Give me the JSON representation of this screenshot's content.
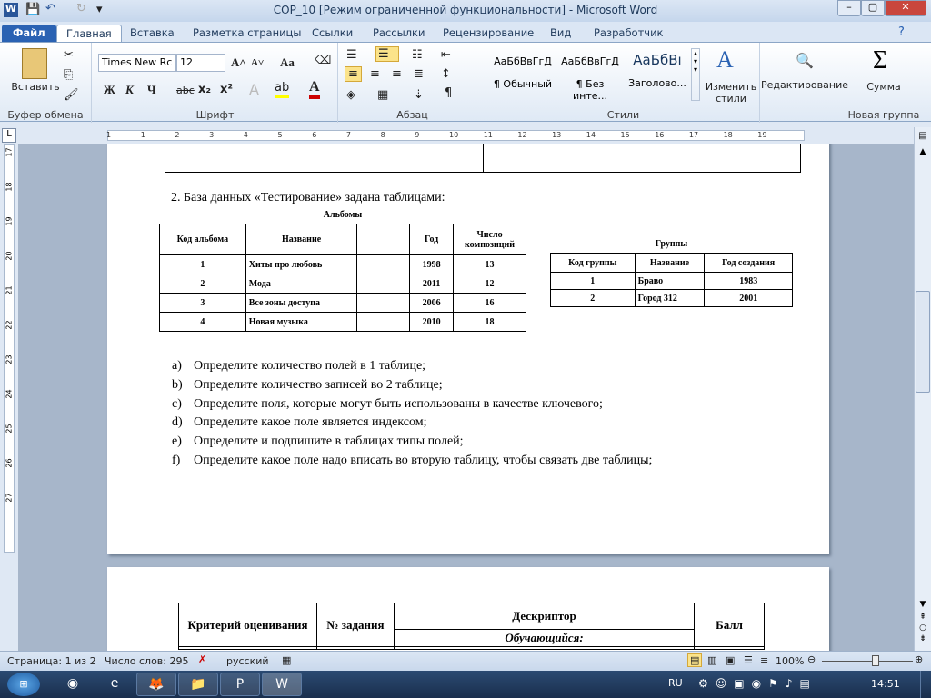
{
  "window": {
    "title": "COP_10 [Режим ограниченной функциональности]  -  Microsoft Word",
    "minimize": "–",
    "maximize": "▢",
    "close": "✕"
  },
  "quick_access": {
    "word": "W",
    "save": "💾",
    "undo": "↶",
    "redo": "↻",
    "customize": "▾"
  },
  "tabs": [
    "Файл",
    "Главная",
    "Вставка",
    "Разметка страницы",
    "Ссылки",
    "Рассылки",
    "Рецензирование",
    "Вид",
    "Разработчик"
  ],
  "ribbon": {
    "clipboard": {
      "paste": "Вставить",
      "label": "Буфер обмена"
    },
    "font": {
      "name": "Times New Rc",
      "size": "12",
      "bold": "Ж",
      "italic": "К",
      "underline": "Ч",
      "strike": "abc",
      "sub": "x₂",
      "sup": "x²",
      "grow": "A˄",
      "shrink": "A˅",
      "case": "Aa",
      "label": "Шрифт"
    },
    "paragraph": {
      "label": "Абзац",
      "pilcrow": "¶"
    },
    "styles": {
      "items": [
        {
          "preview": "АаБбВвГгД",
          "name": "¶ Обычный"
        },
        {
          "preview": "АаБбВвГгД",
          "name": "¶ Без инте..."
        },
        {
          "preview": "АаБбВı",
          "name": "Заголово..."
        }
      ],
      "change": "Изменить стили",
      "label": "Стили"
    },
    "editing": {
      "label": "Редактирование"
    },
    "sum": {
      "label": "Сумма",
      "group": "Новая группа"
    }
  },
  "ruler": {
    "h": [
      "1",
      "1",
      "2",
      "3",
      "4",
      "5",
      "6",
      "7",
      "8",
      "9",
      "10",
      "11",
      "12",
      "13",
      "14",
      "15",
      "16",
      "17",
      "18",
      "19"
    ],
    "v": [
      "17",
      "18",
      "19",
      "20",
      "21",
      "22",
      "23",
      "24",
      "25",
      "26",
      "27"
    ]
  },
  "doc": {
    "item2": "2.   База данных «Тестирование» задана таблицами:",
    "albums": {
      "caption": "Альбомы",
      "headers": [
        "Код альбома",
        "Название",
        "",
        "Год",
        "Число композиций"
      ],
      "rows": [
        [
          "1",
          "Хиты про любовь",
          "",
          "1998",
          "13"
        ],
        [
          "2",
          "Мода",
          "",
          "2011",
          "12"
        ],
        [
          "3",
          "Все зоны доступа",
          "",
          "2006",
          "16"
        ],
        [
          "4",
          "Новая музыка",
          "",
          "2010",
          "18"
        ]
      ]
    },
    "groups": {
      "caption": "Группы",
      "headers": [
        "Код группы",
        "Название",
        "Год создания"
      ],
      "rows": [
        [
          "1",
          "Браво",
          "1983"
        ],
        [
          "2",
          "Город 312",
          "2001"
        ]
      ]
    },
    "questions": [
      {
        "l": "a)",
        "t": "Определите количество полей в 1 таблице;"
      },
      {
        "l": "b)",
        "t": "Определите количество записей во 2 таблице;"
      },
      {
        "l": "c)",
        "t": "Определите поля, которые могут быть использованы в качестве ключевого;"
      },
      {
        "l": "d)",
        "t": "Определите какое поле является индексом;"
      },
      {
        "l": "e)",
        "t": "Определите и подпишите в таблицах типы полей;"
      },
      {
        "l": "f)",
        "t": "Определите какое поле надо вписать во вторую таблицу, чтобы связать две таблицы;"
      }
    ],
    "criteria": {
      "c1": "Критерий оценивания",
      "c2": "№ задания",
      "c3": "Дескриптор",
      "c3sub": "Обучающийся:",
      "c4": "Балл"
    }
  },
  "status": {
    "page": "Страница: 1 из 2",
    "words": "Число слов: 295",
    "lang": "русский",
    "zoom": "100%",
    "zoom_value": 100
  },
  "taskbar": {
    "lang": "RU",
    "time": "14:51"
  }
}
